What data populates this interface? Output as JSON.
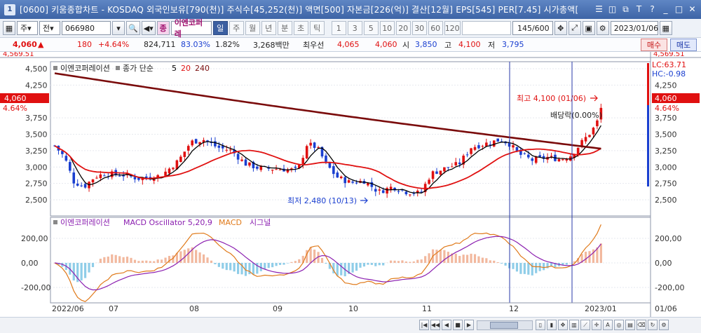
{
  "window": {
    "app_number": "1",
    "title": "[0600] 키움종합차트 - KOSDAQ 외국인보유[790(천)] 주식수[45,252(천)] 액면[500] 자본금[226(억)] 결산[12월] EPS[545] PER[7.45] 시가총액[",
    "buttons": [
      "☰",
      "◫",
      "⧉",
      "T",
      "?",
      "_",
      "□",
      "✕"
    ]
  },
  "toolbar": {
    "market": "주",
    "range": "전",
    "stock_code": "066980",
    "stock_name": "이엔코퍼레",
    "periods": [
      "일",
      "주",
      "월",
      "년",
      "분",
      "초",
      "틱"
    ],
    "active_period": "일",
    "minute_options": [
      "1",
      "3",
      "5",
      "10",
      "20",
      "30",
      "60",
      "120"
    ],
    "count": "145/600",
    "date": "2023/01/06"
  },
  "info": {
    "price": "4,060",
    "arrow": "▲",
    "change": "180",
    "change_pct": "+4.64%",
    "volume": "824,711",
    "vol_ratio": "83.03%",
    "turnover": "1.82%",
    "trade_value": "3,268백만",
    "best_sell_label": "최우선",
    "ask": "4,065",
    "bid": "4,060",
    "open_label": "시",
    "open": "3,850",
    "high_label": "고",
    "high": "4,100",
    "low_label": "저",
    "low": "3,795",
    "buy_btn": "매수",
    "sell_btn": "매도"
  },
  "price_panel": {
    "legend_name": "이엔코퍼레이션",
    "legend_ma": "종가 단순",
    "legend_periods": [
      "5",
      "20",
      "240"
    ],
    "y_ticks": [
      "4,500",
      "4,250",
      "4,060",
      "3,750",
      "3,500",
      "3,250",
      "3,000",
      "2,750",
      "2,500"
    ],
    "right_ticks": [
      "4,250",
      "3,750",
      "3,500",
      "3,250",
      "3,000",
      "2,750",
      "2,500"
    ],
    "left_price_box": "4,060",
    "left_pct": "4.64%",
    "right_price_box": "4,060",
    "right_pct": "4.64%",
    "lc": "LC:63.71",
    "hc": "HC:-0.98",
    "high_annotation": "최고 4,100 (01/06)",
    "low_annotation": "최저 2,480 (10/13)",
    "dividend_annotation": "배당락(0.00%)",
    "top_cut_left": "4,569.51",
    "top_cut_right": "4,569.51"
  },
  "macd_panel": {
    "legend_name": "이엔코퍼레이션",
    "legend_osc": "MACD Oscillator 5,20,9",
    "legend_macd": "MACD",
    "legend_signal": "시그널",
    "y_ticks": [
      "200,00",
      "0,00",
      "-200,00"
    ],
    "right_ticks": [
      "200,00",
      "0,00",
      "-200,00"
    ]
  },
  "x_axis": {
    "labels": [
      "2022/06",
      "07",
      "08",
      "09",
      "10",
      "11",
      "12",
      "2023/01"
    ],
    "right_label": "01/06"
  },
  "colors": {
    "up": "#e01010",
    "down": "#1a3fd0",
    "ma5": "#000000",
    "ma20": "#e01010",
    "ma240": "#7a0b0b",
    "macd": "#e07a1a",
    "signal": "#8b1fb0",
    "osc_pos": "#f2b89e",
    "osc_neg": "#8fcde8"
  },
  "chart_data": {
    "type": "candlestick",
    "title": "이엔코퍼레이션",
    "ylim": [
      2400,
      4569.51
    ],
    "key_points": [
      {
        "label": "최고",
        "date": "01/06",
        "value": 4100
      },
      {
        "label": "최저",
        "date": "10/13",
        "value": 2480
      }
    ],
    "ma240_approx": {
      "start": 4430,
      "end": 3280
    },
    "macd_ylim": [
      -300,
      300
    ]
  }
}
